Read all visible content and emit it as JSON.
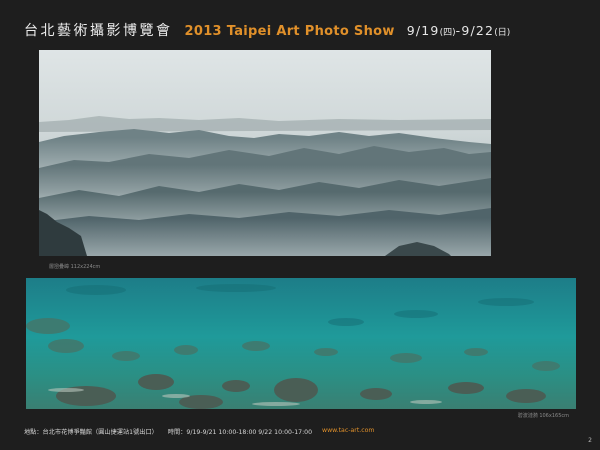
{
  "header": {
    "title_cn": "台北藝術攝影博覽會",
    "title_en": "2013  Taipei Art Photo Show",
    "dates_start": "9/19",
    "dates_start_day": "(四)",
    "dates_sep": "-",
    "dates_end": "9/22",
    "dates_end_day": "(日)"
  },
  "photos": [
    {
      "caption": "層巒疊嶂 112x224cm",
      "subject": "misty mountain ridges"
    },
    {
      "caption": "碧波漣漪 106x165cm",
      "subject": "clear turquoise sea over rocks"
    }
  ],
  "footer": {
    "venue": "地點：台北市花博爭豔館（圓山捷運站1號出口）",
    "hours": "時間：9/19-9/21  10:00-18:00    9/22  10:00-17:00",
    "website": "www.tac-art.com"
  },
  "page_number": "2",
  "colors": {
    "accent": "#e0902a",
    "background": "#1e1e1e"
  }
}
